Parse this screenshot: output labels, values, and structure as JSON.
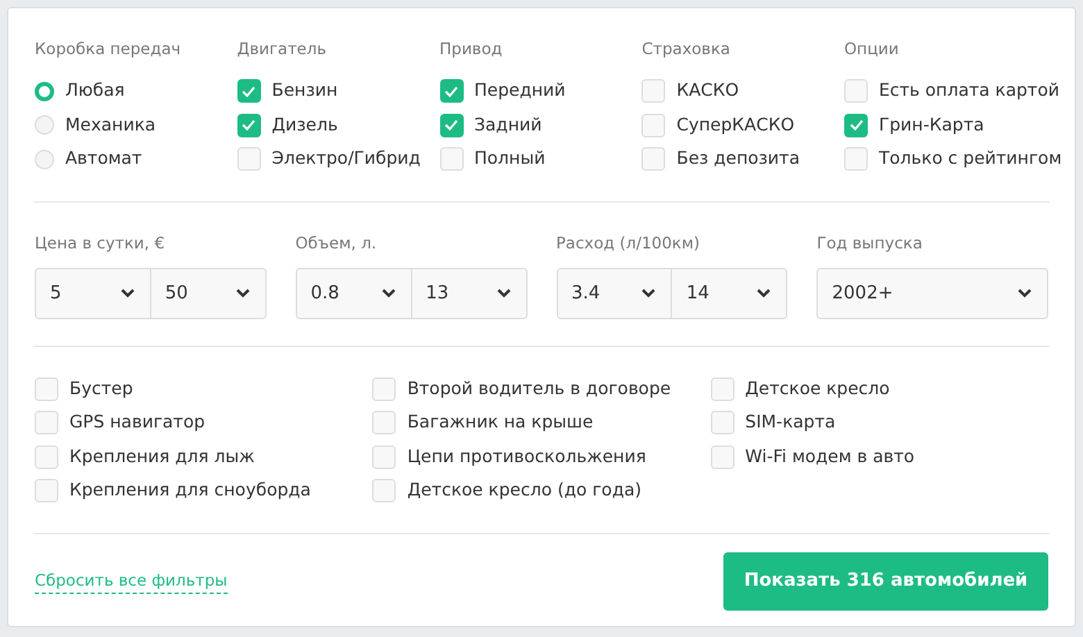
{
  "filter_groups": [
    {
      "title": "Коробка передач",
      "kind": "radio",
      "options": [
        {
          "label": "Любая",
          "selected": true
        },
        {
          "label": "Механика",
          "selected": false
        },
        {
          "label": "Автомат",
          "selected": false
        }
      ]
    },
    {
      "title": "Двигатель",
      "kind": "checkbox",
      "options": [
        {
          "label": "Бензин",
          "checked": true
        },
        {
          "label": "Дизель",
          "checked": true
        },
        {
          "label": "Электро/Гибрид",
          "checked": false
        }
      ]
    },
    {
      "title": "Привод",
      "kind": "checkbox",
      "options": [
        {
          "label": "Передний",
          "checked": true
        },
        {
          "label": "Задний",
          "checked": true
        },
        {
          "label": "Полный",
          "checked": false
        }
      ]
    },
    {
      "title": "Страховка",
      "kind": "checkbox",
      "options": [
        {
          "label": "КАСКО",
          "checked": false
        },
        {
          "label": "СуперКАСКО",
          "checked": false
        },
        {
          "label": "Без депозита",
          "checked": false
        }
      ]
    },
    {
      "title": "Опции",
      "kind": "checkbox",
      "options": [
        {
          "label": "Есть оплата картой",
          "checked": false
        },
        {
          "label": "Грин-Карта",
          "checked": true
        },
        {
          "label": "Только с рейтингом",
          "checked": false
        }
      ]
    }
  ],
  "ranges": [
    {
      "label": "Цена в сутки, €",
      "selects": [
        "5",
        "50"
      ]
    },
    {
      "label": "Объем, л.",
      "selects": [
        "0.8",
        "13"
      ]
    },
    {
      "label": "Расход (л/100км)",
      "selects": [
        "3.4",
        "14"
      ]
    },
    {
      "label": "Год выпуска",
      "selects": [
        "2002+"
      ]
    }
  ],
  "extras": [
    [
      {
        "label": "Бустер",
        "checked": false
      },
      {
        "label": "GPS навигатор",
        "checked": false
      },
      {
        "label": "Крепления для лыж",
        "checked": false
      },
      {
        "label": "Крепления для сноуборда",
        "checked": false
      }
    ],
    [
      {
        "label": "Второй водитель в договоре",
        "checked": false
      },
      {
        "label": "Багажник на крыше",
        "checked": false
      },
      {
        "label": "Цепи противоскольжения",
        "checked": false
      },
      {
        "label": "Детское кресло (до года)",
        "checked": false
      }
    ],
    [
      {
        "label": "Детское кресло",
        "checked": false
      },
      {
        "label": "SIM-карта",
        "checked": false
      },
      {
        "label": "Wi-Fi модем в авто",
        "checked": false
      }
    ]
  ],
  "footer": {
    "reset_link": "Сбросить все фильтры",
    "show_button": "Показать 316 автомобилей"
  }
}
